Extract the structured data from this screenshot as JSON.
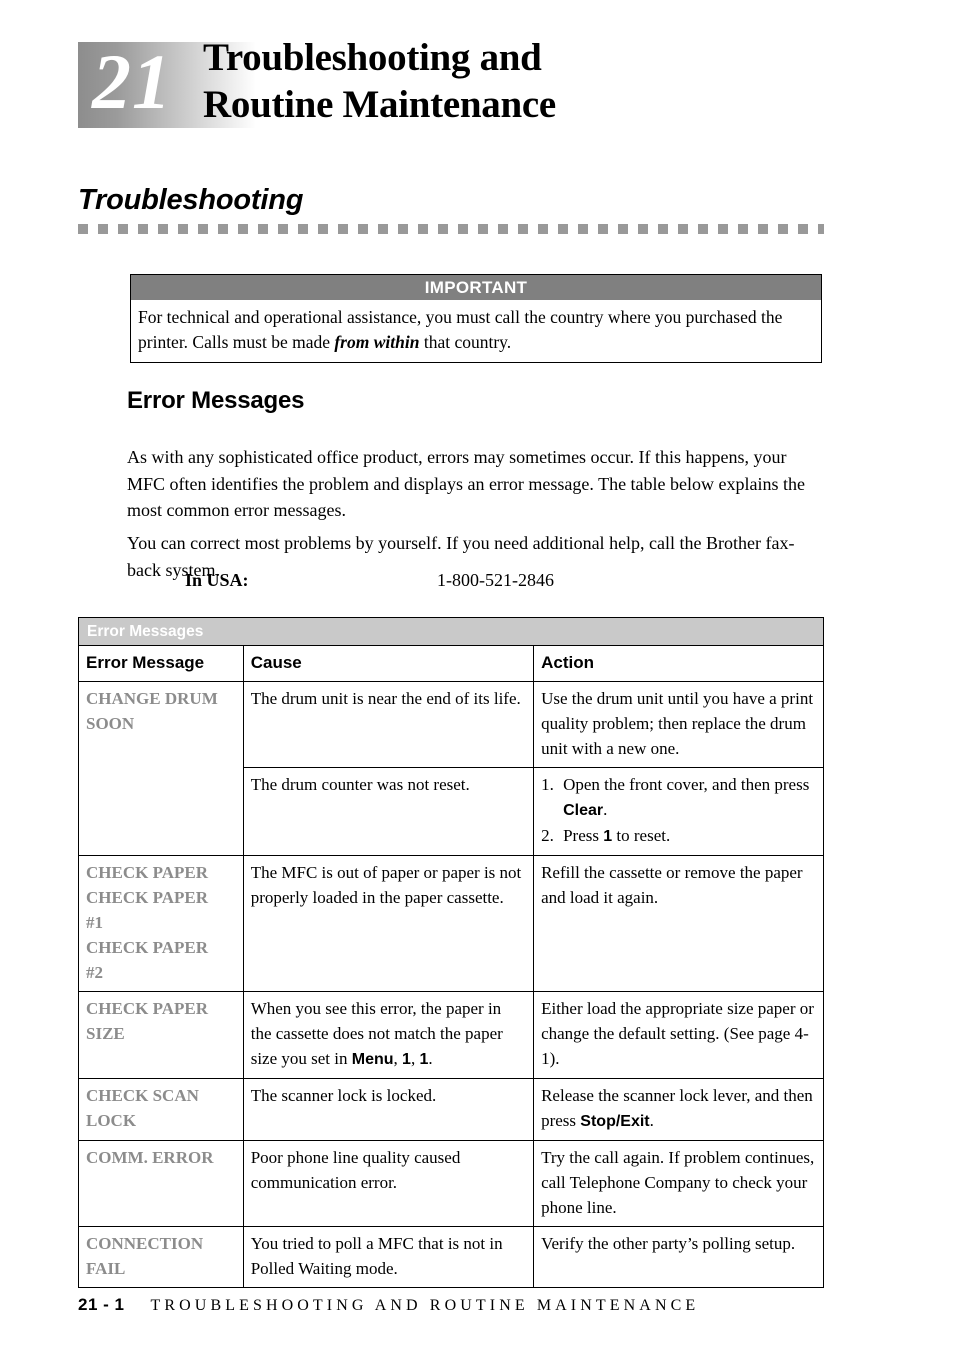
{
  "chapter": {
    "number": "21",
    "title": "Troubleshooting and\nRoutine Maintenance"
  },
  "section": {
    "heading": "Troubleshooting"
  },
  "important_box": {
    "title": "IMPORTANT",
    "text_before": "For technical and operational assistance, you must call the country where you purchased the printer. Calls must be made ",
    "emphasis": "from within",
    "text_after": " that country."
  },
  "error_messages_section": {
    "heading": "Error Messages",
    "paragraph_1": "As with any sophisticated office product, errors may sometimes occur. If this happens, your MFC often identifies the problem and displays an error message. The table below explains the most common error messages.",
    "paragraph_2": "You can correct most problems by yourself. If you need additional help, call the Brother fax-back system.",
    "usa_label": "In USA:",
    "usa_number": "1-800-521-2846"
  },
  "table": {
    "caption": "Error Messages",
    "columns": [
      "Error Message",
      "Cause",
      "Action"
    ],
    "rows": [
      {
        "code_line_1": "CHANGE DRUM",
        "code_line_2": "SOON",
        "cause": "The drum unit is near the end of its life.",
        "action": "Use the drum unit until you have a print quality problem; then replace the drum unit with a new one."
      },
      {
        "cause": "The drum counter was not reset.",
        "steps": [
          {
            "num": "1.",
            "text_before": "Open the front cover, and then press ",
            "kbd": "Clear",
            "text_after": "."
          },
          {
            "num": "2.",
            "text_before": "Press ",
            "kbd": "1",
            "text_after": " to reset."
          }
        ]
      },
      {
        "code_line_1": "CHECK PAPER",
        "code_line_2": "CHECK PAPER",
        "code_line_3": "#1",
        "code_line_4": "CHECK PAPER",
        "code_line_5": "#2",
        "cause": "The MFC is out of paper or paper is not properly loaded in the paper cassette.",
        "action": "Refill the cassette or remove the paper and load it again."
      },
      {
        "code_line_1": "CHECK PAPER",
        "code_line_2": "SIZE",
        "cause_before": "When you see this error, the paper in the cassette does not match the paper size you set in ",
        "cause_kbd_1": "Menu",
        "cause_mid_1": ", ",
        "cause_kbd_2": "1",
        "cause_mid_2": ", ",
        "cause_kbd_3": "1",
        "cause_after": ".",
        "action": "Either load the appropriate size paper or change the default setting. (See page 4-1)."
      },
      {
        "code_line_1": "CHECK SCAN",
        "code_line_2": "LOCK",
        "cause": "The scanner lock is locked.",
        "action_before": "Release the scanner lock lever, and then press ",
        "action_kbd": "Stop/Exit",
        "action_after": "."
      },
      {
        "code_line_1": "COMM. ERROR",
        "cause": "Poor phone line quality caused communication error.",
        "action": "Try the call again. If problem continues, call Telephone Company to check your phone line."
      },
      {
        "code_line_1": "CONNECTION",
        "code_line_2": "FAIL",
        "cause": "You tried to poll a MFC that is not in Polled Waiting mode.",
        "action": "Verify the other party’s polling setup."
      }
    ]
  },
  "footer": {
    "page": "21 - 1",
    "title": "TROUBLESHOOTING AND ROUTINE MAINTENANCE"
  }
}
